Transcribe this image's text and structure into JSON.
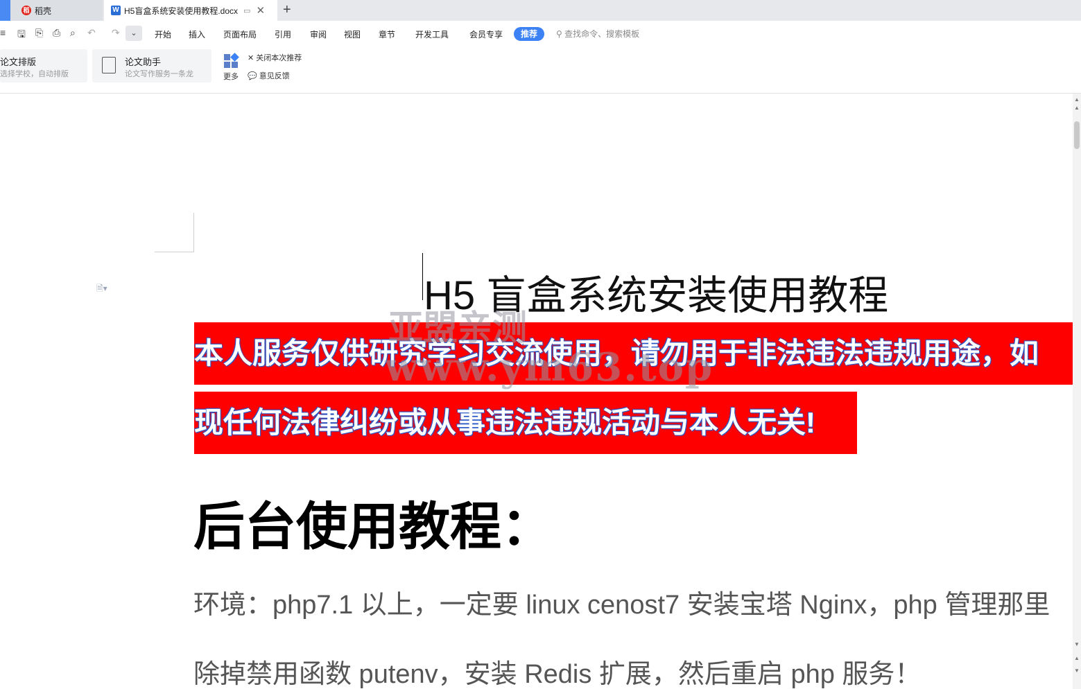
{
  "tabs": [
    {
      "label": "稻壳",
      "icon": "docer-icon"
    },
    {
      "label": "H5盲盒系统安装使用教程.docx",
      "icon": "word-doc-icon"
    }
  ],
  "menu": {
    "items": [
      "开始",
      "插入",
      "页面布局",
      "引用",
      "审阅",
      "视图",
      "章节",
      "开发工具",
      "会员专享"
    ],
    "recommend": "推荐",
    "search_placeholder": "查找命令、搜索模板"
  },
  "ribbon": {
    "card1": {
      "title": "论文排版",
      "subtitle": "选择学校，自动排版"
    },
    "card2": {
      "title": "论文助手",
      "subtitle": "论文写作服务一条龙"
    },
    "more": "更多",
    "close_rec": "关闭本次推荐",
    "feedback": "意见反馈"
  },
  "document": {
    "title": "H5 盲盒系统安装使用教程",
    "warning_line1": "本人服务仅供研究学习交流使用，请勿用于非法违法违规用途，如",
    "warning_line2": "现任何法律纠纷或从事违法违规活动与本人无关!",
    "watermark_line1": "亚盟亲测",
    "watermark_line2": "www.ym63.top",
    "heading": "后台使用教程：",
    "body_line1": "环境：php7.1 以上，一定要 linux cenost7 安装宝塔 Nginx，php 管理那里",
    "body_line2": "除掉禁用函数 putenv，安装 Redis 扩展，然后重启 php 服务！"
  }
}
